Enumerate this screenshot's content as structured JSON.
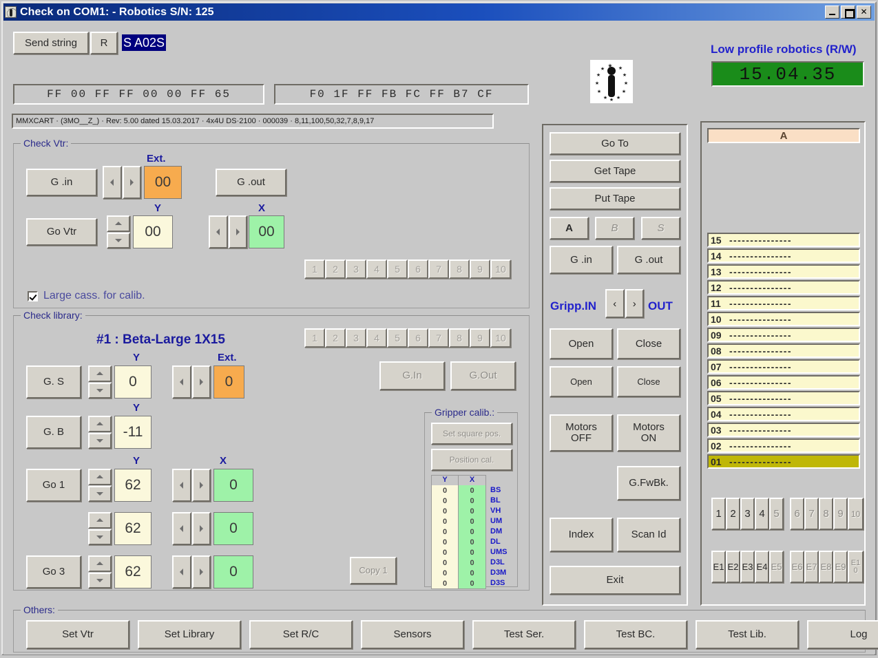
{
  "window": {
    "title": "Check on COM1: - Robotics S/N: 125",
    "icon": "robot-icon",
    "minimize": "_",
    "maximize": "□",
    "close": "✕"
  },
  "toolbar": {
    "send_string_label": "Send string",
    "r_button_label": "R",
    "command_value": "S A02S"
  },
  "status": {
    "hex_left": "FF  00  FF  FF  00  00  FF  65",
    "hex_right": "F0  1F  FF  FB  FC  FF  B7  CF",
    "info_line": "MMXCART · (3MO__Z_) · Rev: 5.00 dated 15.03.2017 · 4x4U DS·2100 · 000039 · 8,11,100,50,32,7,8,9,17"
  },
  "branding": {
    "title": "Low profile robotics (R/W)",
    "clock": "15.04.35",
    "logo": "eu-robot-logo"
  },
  "check_vtr": {
    "title": "Check Vtr:",
    "g_in": "G .in",
    "g_out": "G .out",
    "go_vtr": "Go Vtr",
    "ext_label": "Ext.",
    "ext_value": "00",
    "y_label": "Y",
    "y_value": "00",
    "x_label": "X",
    "x_value": "00",
    "checkbox_label": "Large cass. for calib.",
    "checkbox_checked": true,
    "num_buttons": [
      "1",
      "2",
      "3",
      "4",
      "5",
      "6",
      "7",
      "8",
      "9",
      "10"
    ]
  },
  "check_library": {
    "title": "Check library:",
    "header": "#1 : Beta-Large 1X15",
    "num_buttons": [
      "1",
      "2",
      "3",
      "4",
      "5",
      "6",
      "7",
      "8",
      "9",
      "10"
    ],
    "g_in": "G.In",
    "g_out": "G.Out",
    "copy_button": "Copy 1",
    "rows": [
      {
        "button": "G. S",
        "y_label": "Y",
        "y_value": "0",
        "second_label": "Ext.",
        "second_value": "0",
        "second_type": "ext"
      },
      {
        "button": "G. B",
        "y_label": "Y",
        "y_value": "-11",
        "second_label": "",
        "second_value": "",
        "second_type": "none"
      },
      {
        "button": "Go 1",
        "y_label": "Y",
        "y_value": "62",
        "second_label": "X",
        "second_value": "0",
        "second_type": "x"
      },
      {
        "button": "",
        "y_label": "",
        "y_value": "62",
        "second_label": "",
        "second_value": "0",
        "second_type": "x"
      },
      {
        "button": "Go 3",
        "y_label": "",
        "y_value": "62",
        "second_label": "",
        "second_value": "0",
        "second_type": "x"
      }
    ]
  },
  "gripper_calib": {
    "title": "Gripper calib.:",
    "set_square_pos": "Set square pos.",
    "position_cal": "Position cal.",
    "col_y": "Y",
    "col_x": "X",
    "rows": [
      {
        "y": "0",
        "x": "0",
        "name": "BS"
      },
      {
        "y": "0",
        "x": "0",
        "name": "BL"
      },
      {
        "y": "0",
        "x": "0",
        "name": "VH"
      },
      {
        "y": "0",
        "x": "0",
        "name": "UM"
      },
      {
        "y": "0",
        "x": "0",
        "name": "DM"
      },
      {
        "y": "0",
        "x": "0",
        "name": "DL"
      },
      {
        "y": "0",
        "x": "0",
        "name": "UMS"
      },
      {
        "y": "0",
        "x": "0",
        "name": "D3L"
      },
      {
        "y": "0",
        "x": "0",
        "name": "D3M"
      },
      {
        "y": "0",
        "x": "0",
        "name": "D3S"
      }
    ]
  },
  "commands": {
    "go_to": "Go To",
    "get_tape": "Get Tape",
    "put_tape": "Put Tape",
    "mode_a": "A",
    "mode_b": "B",
    "mode_s": "S",
    "g_in": "G .in",
    "g_out": "G .out",
    "gripp_in_label": "Gripp.IN",
    "gripp_out_label": "OUT",
    "gripp_prev": "‹",
    "gripp_next": "›",
    "open_big": "Open",
    "close_big": "Close",
    "open_small": "Open",
    "close_small": "Close",
    "motors_off": "Motors\nOFF",
    "motors_on": "Motors\nON",
    "g_fwbk": "G.FwBk.",
    "index": "Index",
    "scan_id": "Scan Id",
    "exit": "Exit"
  },
  "library_panel": {
    "header_letter": "A",
    "slot_dashes": "---------------",
    "slots": [
      {
        "id": "15",
        "value": "---------------",
        "selected": false
      },
      {
        "id": "14",
        "value": "---------------",
        "selected": false
      },
      {
        "id": "13",
        "value": "---------------",
        "selected": false
      },
      {
        "id": "12",
        "value": "---------------",
        "selected": false
      },
      {
        "id": "11",
        "value": "---------------",
        "selected": false
      },
      {
        "id": "10",
        "value": "---------------",
        "selected": false
      },
      {
        "id": "09",
        "value": "---------------",
        "selected": false
      },
      {
        "id": "08",
        "value": "---------------",
        "selected": false
      },
      {
        "id": "07",
        "value": "---------------",
        "selected": false
      },
      {
        "id": "06",
        "value": "---------------",
        "selected": false
      },
      {
        "id": "05",
        "value": "---------------",
        "selected": false
      },
      {
        "id": "04",
        "value": "---------------",
        "selected": false
      },
      {
        "id": "03",
        "value": "---------------",
        "selected": false
      },
      {
        "id": "02",
        "value": "---------------",
        "selected": false
      },
      {
        "id": "01",
        "value": "---------------",
        "selected": true
      }
    ],
    "drive_buttons_a": [
      "1",
      "2",
      "3",
      "4",
      "5"
    ],
    "drive_buttons_b": [
      "6",
      "7",
      "8",
      "9",
      "10"
    ],
    "elem_buttons_a": [
      "E1",
      "E2",
      "E3",
      "E4",
      "E5"
    ],
    "elem_buttons_b": [
      "E6",
      "E7",
      "E8",
      "E9",
      "E10"
    ]
  },
  "others": {
    "title": "Others:",
    "buttons": [
      "Set Vtr",
      "Set Library",
      "Set R/C",
      "Sensors",
      "Test Ser.",
      "Test BC.",
      "Test Lib.",
      "Log"
    ]
  },
  "colors": {
    "face": "#c8c8c8",
    "y_field": "#fbf8dc",
    "x_field": "#9ef2a8",
    "ext_field": "#f7ab4e",
    "clock_bg": "#1a8c1a",
    "slot_bg": "#fbf8cd",
    "slot_selected": "#bfb707",
    "accent_blue": "#1a1a9e"
  }
}
